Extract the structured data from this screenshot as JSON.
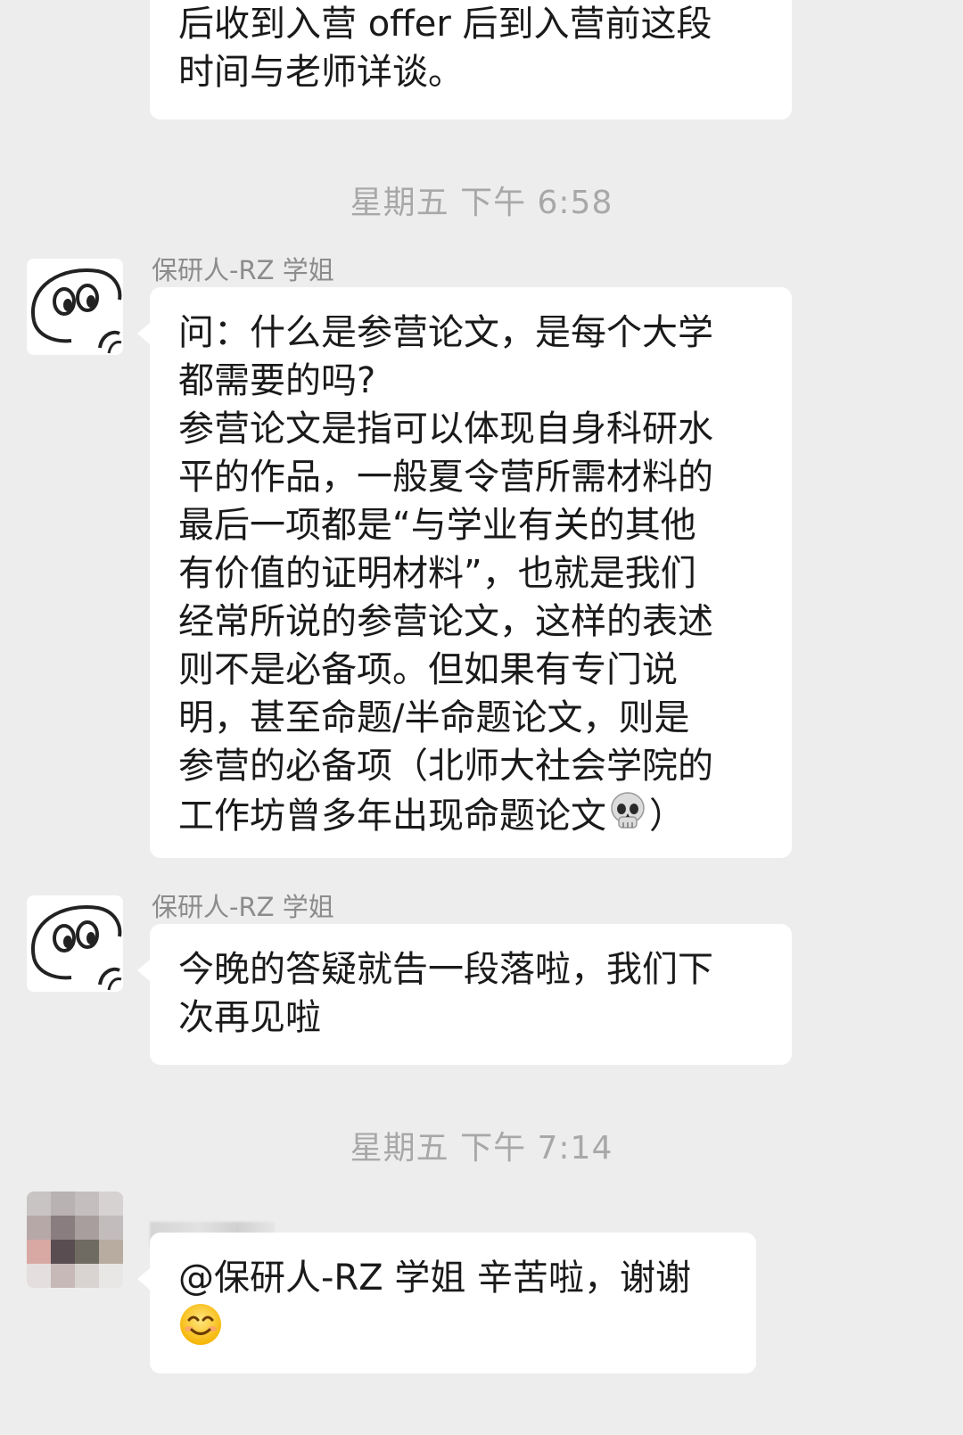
{
  "messages": [
    {
      "id": "m0",
      "text": "后收到入营 offer 后到入营前这段\n时间与老师详谈。"
    },
    {
      "id": "m1",
      "sender": "保研人-RZ 学姐",
      "text": "问：什么是参营论文，是每个大学\n都需要的吗?\n参营论文是指可以体现自身科研水\n平的作品，一般夏令营所需材料的\n最后一项都是“与学业有关的其他\n有价值的证明材料”，也就是我们\n经常所说的参营论文，这样的表述\n则不是必备项。但如果有专门说\n明，甚至命题/半命题论文，则是\n参营的必备项（北师大社会学院的\n工作坊曾多年出现命题论文",
      "text_tail": "）"
    },
    {
      "id": "m2",
      "sender": "保研人-RZ 学姐",
      "text": "今晚的答疑就告一段落啦，我们下\n次再见啦"
    },
    {
      "id": "m3",
      "text": "@保研人-RZ 学姐 辛苦啦，谢谢"
    }
  ],
  "timestamps": {
    "t1": "星期五 下午 6:58",
    "t2": "星期五 下午 7:14"
  },
  "icons": {
    "m1_emoji": "skull-emoji",
    "m3_emoji": "smiling-face-emoji",
    "rz_avatar": "cartoon-face-avatar",
    "user_avatar": "pixelated-avatar"
  },
  "colors": {
    "background": "#ededed",
    "bubble": "#ffffff",
    "timestamp": "#a8a8a8",
    "sender": "#8c8c8c"
  }
}
